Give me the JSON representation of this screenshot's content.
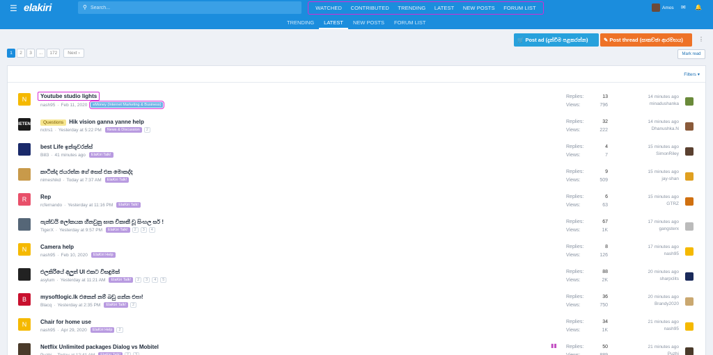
{
  "header": {
    "logo": "elakiri",
    "search_placeholder": "Search...",
    "nav": [
      "WATCHED",
      "CONTRIBUTED",
      "TRENDING",
      "LATEST",
      "NEW POSTS",
      "FORUM LIST"
    ],
    "user": "Amos"
  },
  "subnav": {
    "items": [
      "TRENDING",
      "LATEST",
      "NEW POSTS",
      "FORUM LIST"
    ],
    "active": "LATEST"
  },
  "actions": {
    "post_ad": "Post ad (දැන්වීම පළකරන්න)",
    "post_thread": "Post thread (සාකච්ඡා ආරම්භය)",
    "mark_read": "Mark read",
    "filters": "Filters"
  },
  "pager": {
    "pages": [
      "1",
      "2",
      "3",
      "...",
      "172"
    ],
    "current": "1",
    "next": "Next ›"
  },
  "labels": {
    "replies": "Replies:",
    "views": "Views:"
  },
  "threads": [
    {
      "avatar": "N",
      "avatar_color": "#f5b900",
      "title": "Youtube studio lights",
      "prefix": "",
      "user": "nash95",
      "date": "Feb 11, 2020",
      "tag": "eMoney (Internet Marketing & Business)",
      "pages": [],
      "replies": "13",
      "views": "796",
      "time": "14 minutes ago",
      "last_user": "minadushanka",
      "last_color": "#6a8a3a"
    },
    {
      "avatar": "IETEN",
      "avatar_color": "#1a1a1a",
      "title": "Hik vision ganna yanne help",
      "prefix": "Questions",
      "user": "nctrs1",
      "date": "Yesterday at 5:22 PM",
      "tag": "News & Discussion",
      "pages": [
        "2"
      ],
      "replies": "32",
      "views": "222",
      "time": "14 minutes ago",
      "last_user": "Dhanushka.N",
      "last_color": "#8a5a3a"
    },
    {
      "avatar": "",
      "avatar_color": "#1a2a6a",
      "title": "best Life ඉන්ශුවරන්ස්",
      "prefix": "",
      "user": "Bill3",
      "date": "41 minutes ago",
      "tag": "ElaKiri Talk!",
      "pages": [],
      "replies": "4",
      "views": "7",
      "time": "15 minutes ago",
      "last_user": "SimonRiley",
      "last_color": "#5a4030"
    },
    {
      "avatar": "",
      "avatar_color": "#c89a4a",
      "title": "කාටින්ද ජයරත්න ගේ සෙස් එක මොකද්ද",
      "prefix": "",
      "user": "nimeshikd",
      "date": "Today at 7:37 AM",
      "tag": "ElaKiri Talk!",
      "pages": [],
      "replies": "9",
      "views": "509",
      "time": "15 minutes ago",
      "last_user": "jay-shan",
      "last_color": "#e0a020"
    },
    {
      "avatar": "R",
      "avatar_color": "#e8506a",
      "title": "Rep",
      "prefix": "",
      "user": "rcfernando",
      "date": "Yesterday at 11:16 PM",
      "tag": "ElaKiri Talk!",
      "pages": [],
      "replies": "6",
      "views": "63",
      "time": "15 minutes ago",
      "last_user": "GTRZ",
      "last_color": "#d07010"
    },
    {
      "avatar": "",
      "avatar_color": "#556677",
      "title": "පැන්ඩයි ලෝකයක හීනවුනු ඝාන චිකාකී චූ සිංහල සර් !",
      "prefix": "",
      "user": "TigerX",
      "date": "Yesterday at 9:57 PM",
      "tag": "ElaKiri Talk!",
      "pages": [
        "2",
        "3",
        "4"
      ],
      "replies": "67",
      "views": "1K",
      "time": "17 minutes ago",
      "last_user": "gangsterx",
      "last_color": "#bbbbbb"
    },
    {
      "avatar": "N",
      "avatar_color": "#f5b900",
      "title": "Camera help",
      "prefix": "",
      "user": "nash95",
      "date": "Feb 10, 2020",
      "tag": "ElaKiri Help",
      "pages": [],
      "replies": "8",
      "views": "126",
      "time": "17 minutes ago",
      "last_user": "nash95",
      "last_color": "#f5b900"
    },
    {
      "avatar": "",
      "avatar_color": "#222222",
      "title": "එලකිරියේ අලුත් UI එකට විසඳුමක්",
      "prefix": "",
      "user": "asylum",
      "date": "Yesterday at 11:21 AM",
      "tag": "ElaKiri Talk!",
      "pages": [
        "2",
        "3",
        "4",
        "5"
      ],
      "replies": "88",
      "views": "2K",
      "time": "20 minutes ago",
      "last_user": "sharpclits",
      "last_color": "#1a2a5a"
    },
    {
      "avatar": "B",
      "avatar_color": "#c8102e",
      "title": "mysoftlogic.lk එකෙන් නම් බඩු ගන්න එපා!",
      "prefix": "",
      "user": "Blacq",
      "date": "Yesterday at 2:35 PM",
      "tag": "ElaKiri Talk!",
      "pages": [
        "2"
      ],
      "replies": "36",
      "views": "750",
      "time": "20 minutes ago",
      "last_user": "Brandy2020",
      "last_color": "#caa870"
    },
    {
      "avatar": "N",
      "avatar_color": "#f5b900",
      "title": "Chair for home use",
      "prefix": "",
      "user": "nash95",
      "date": "Apr 29, 2020",
      "tag": "ElaKiri Help",
      "pages": [
        "2"
      ],
      "replies": "34",
      "views": "1K",
      "time": "21 minutes ago",
      "last_user": "nash95",
      "last_color": "#f5b900"
    },
    {
      "avatar": "",
      "avatar_color": "#4a3a2a",
      "title": "Netflix Unlimited packages Dialog vs Mobitel",
      "prefix": "",
      "user": "Puzhi",
      "date": "Today at 12:41 AM",
      "tag": "ElaKiri Talk!",
      "pages": [
        "2",
        "3"
      ],
      "replies": "50",
      "views": "889",
      "time": "21 minutes ago",
      "last_user": "Puzhi",
      "last_color": "#4a3a2a"
    }
  ]
}
